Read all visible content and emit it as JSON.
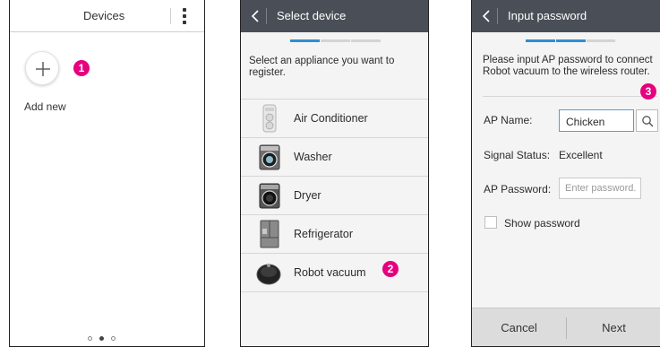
{
  "screen1": {
    "title": "Devices",
    "add_label": "Add new",
    "callout": "1",
    "pager": [
      "inactive",
      "active",
      "inactive"
    ]
  },
  "screen2": {
    "title": "Select device",
    "instructions": "Select an appliance you want to register.",
    "progress_step": 1,
    "progress_total": 3,
    "appliances": [
      {
        "label": "Air Conditioner",
        "icon": "air-conditioner-icon"
      },
      {
        "label": "Washer",
        "icon": "washer-icon"
      },
      {
        "label": "Dryer",
        "icon": "dryer-icon"
      },
      {
        "label": "Refrigerator",
        "icon": "refrigerator-icon"
      },
      {
        "label": "Robot vacuum",
        "icon": "robot-vacuum-icon"
      }
    ],
    "callout": "2"
  },
  "screen3": {
    "title": "Input password",
    "instructions": "Please input AP password to connect Robot vacuum to the wireless router.",
    "progress_step": 2,
    "progress_total": 3,
    "ap_name_label": "AP Name:",
    "ap_name_value": "Chicken",
    "signal_label": "Signal Status:",
    "signal_value": "Excellent",
    "ap_password_label": "AP Password:",
    "ap_password_placeholder": "Enter password.",
    "show_password_label": "Show password",
    "cancel_label": "Cancel",
    "next_label": "Next",
    "callout": "3"
  },
  "colors": {
    "accent": "#2e8fd0",
    "callout": "#e6007e",
    "topbar": "#4a4f57"
  }
}
